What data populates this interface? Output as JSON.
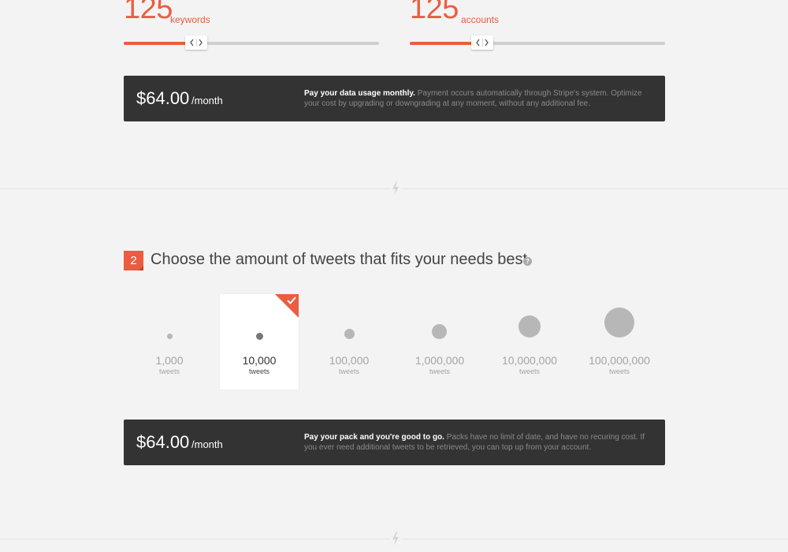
{
  "sliders": [
    {
      "value": "125",
      "unit": "keywords",
      "fill_fraction": 0.26
    },
    {
      "value": "125",
      "unit": "accounts",
      "fill_fraction": 0.26
    }
  ],
  "plan1": {
    "price": "$64.00",
    "period": "/month",
    "desc_strong": "Pay your data usage monthly.",
    "desc_rest": "Payment occurs automatically through Stripe's system. Optimize your cost by upgrading or downgrading at any moment, without any additional fee."
  },
  "step2": {
    "number": "2",
    "title": "Choose the amount of tweets that fits your needs best",
    "help": "?"
  },
  "tweet_options": [
    {
      "value": "1,000",
      "label": "tweets",
      "selected": false
    },
    {
      "value": "10,000",
      "label": "tweets",
      "selected": true
    },
    {
      "value": "100,000",
      "label": "tweets",
      "selected": false
    },
    {
      "value": "1,000,000",
      "label": "tweets",
      "selected": false
    },
    {
      "value": "10,000,000",
      "label": "tweets",
      "selected": false
    },
    {
      "value": "100,000,000",
      "label": "tweets",
      "selected": false
    }
  ],
  "plan2": {
    "price": "$64.00",
    "period": "/month",
    "desc_strong": "Pay your pack and you're good to go.",
    "desc_rest": "Packs have no limit of date, and have no recuring cost. If you ever need additional tweets to be retrieved, you can top up from your account."
  },
  "colors": {
    "accent": "#ec5c40",
    "dark_bar": "#333333",
    "background": "#f3f3f3"
  },
  "icons": [
    "chevron-left-icon",
    "chevron-right-icon",
    "lightning-bolt-icon",
    "help-icon",
    "checkmark-icon"
  ]
}
